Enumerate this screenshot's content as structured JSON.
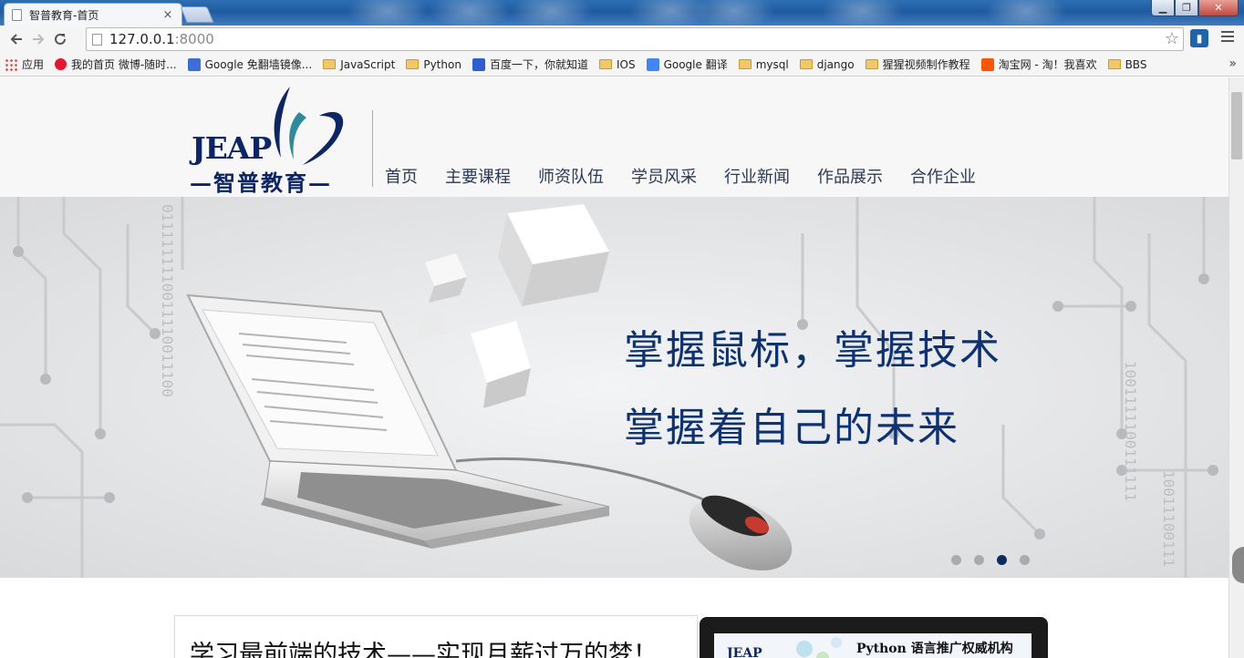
{
  "browser": {
    "tab_title": "智普教育-首页",
    "tab_close": "×",
    "url_host": "127.0.0.1",
    "url_port": ":8000",
    "star": "☆"
  },
  "bookmarks": [
    {
      "label": "应用",
      "icon": "apps-grid-icon"
    },
    {
      "label": "我的首页 微博-随时...",
      "icon": "weibo-icon"
    },
    {
      "label": "Google 免翻墙镜像...",
      "icon": "google-8-icon"
    },
    {
      "label": "JavaScript",
      "icon": "folder-icon"
    },
    {
      "label": "Python",
      "icon": "folder-icon"
    },
    {
      "label": "百度一下，你就知道",
      "icon": "baidu-paw-icon"
    },
    {
      "label": "IOS",
      "icon": "folder-icon"
    },
    {
      "label": "Google 翻译",
      "icon": "google-translate-icon"
    },
    {
      "label": "mysql",
      "icon": "folder-icon"
    },
    {
      "label": "django",
      "icon": "folder-icon"
    },
    {
      "label": "猩猩视频制作教程",
      "icon": "folder-icon"
    },
    {
      "label": "淘宝网 - 淘！我喜欢",
      "icon": "taobao-icon"
    },
    {
      "label": "BBS",
      "icon": "folder-icon"
    }
  ],
  "site": {
    "logo_text": "JEAP",
    "logo_cn": "—智普教育—",
    "nav": [
      "首页",
      "主要课程",
      "师资队伍",
      "学员风采",
      "行业新闻",
      "作品展示",
      "合作企业"
    ]
  },
  "banner": {
    "line1": "掌握鼠标，掌握技术",
    "line2": "掌握着自己的未来",
    "active_slide": 3,
    "slide_count": 4
  },
  "content": {
    "headline": "学习最前端的技术——实现月薪过万的梦！",
    "video_logo": "JEAP",
    "video_title": "Python 语言推广权威机构"
  },
  "colors": {
    "brand_navy": "#0c2566",
    "slogan": "#0d3274",
    "dot_active": "#0d2c63",
    "dot_inactive": "#a9abad"
  }
}
